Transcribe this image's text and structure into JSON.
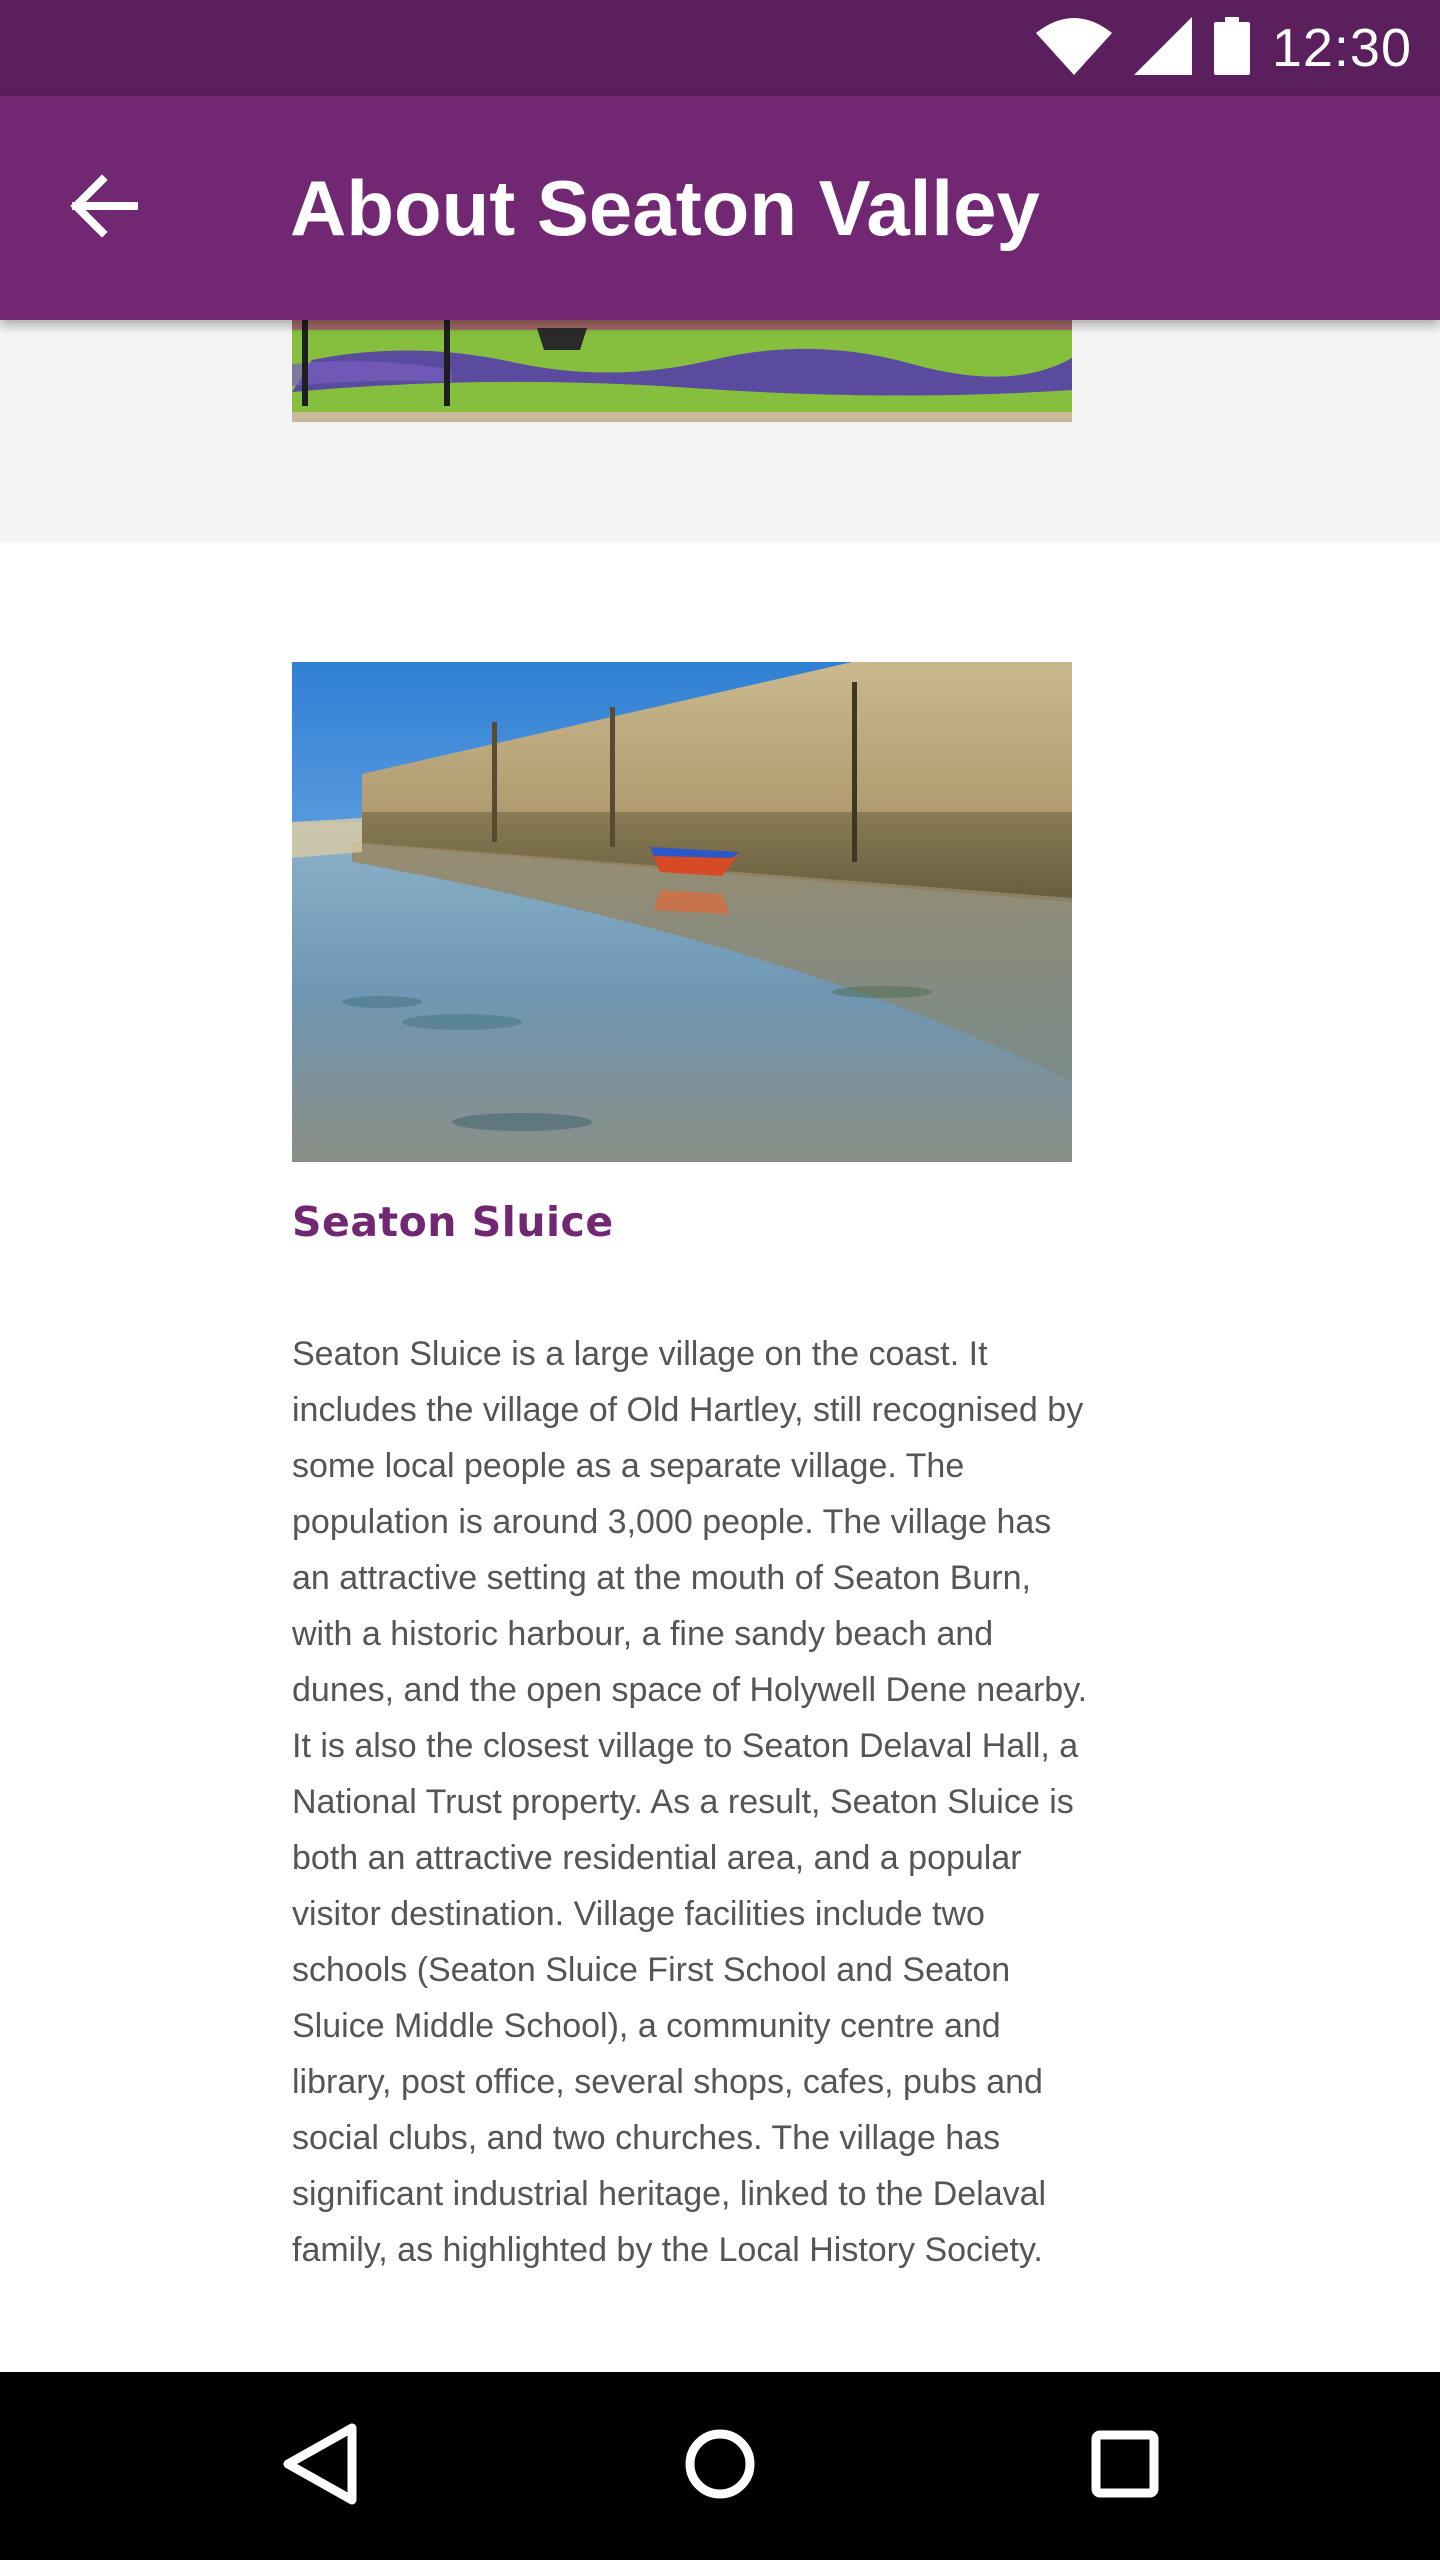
{
  "status_bar": {
    "time": "12:30",
    "icons": [
      "wifi-icon",
      "cell-signal-icon",
      "battery-icon"
    ]
  },
  "app_bar": {
    "title": "About Seaton Valley",
    "back_icon": "arrow-back-icon",
    "color": "#722772"
  },
  "section": {
    "heading": "Seaton Sluice",
    "body": "Seaton Sluice is a large village on the coast. It includes the village of Old Hartley, still recognised by some local people as a separate village. The population is around 3,000 people. The village has an attractive setting at the mouth of Seaton Burn, with a historic harbour, a fine sandy beach and dunes, and the open space of Holywell Dene nearby. It is also the closest village to Seaton Delaval Hall, a National Trust property. As a result, Seaton Sluice is both an attractive residential area, and a popular visitor destination. Village facilities include two schools (Seaton Sluice First School and Seaton Sluice Middle School), a community centre and library, post office, several shops, cafes, pubs and social clubs, and two churches. The village has significant industrial heritage, linked to the Delaval family, as highlighted by the Local History Society.",
    "heading_color": "#722772"
  },
  "nav_bar": {
    "icons": [
      "back-triangle-icon",
      "home-circle-icon",
      "recents-square-icon"
    ]
  }
}
